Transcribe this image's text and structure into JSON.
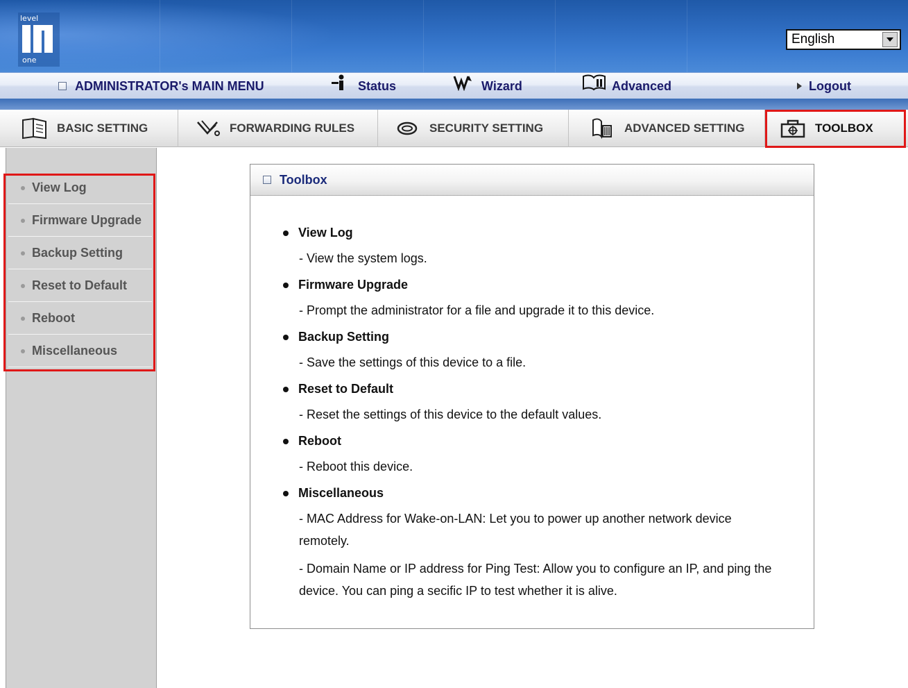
{
  "header": {
    "logo_text": [
      "level",
      "one"
    ],
    "language": "English"
  },
  "main_menu": {
    "title": "ADMINISTRATOR's MAIN MENU",
    "status": "Status",
    "wizard": "Wizard",
    "advanced": "Advanced",
    "logout": "Logout"
  },
  "tabs": [
    {
      "label": "BASIC SETTING",
      "icon": "book-icon"
    },
    {
      "label": "FORWARDING RULES",
      "icon": "forward-arrows-icon"
    },
    {
      "label": "SECURITY SETTING",
      "icon": "lock-chain-icon"
    },
    {
      "label": "ADVANCED SETTING",
      "icon": "advanced-book-icon"
    },
    {
      "label": "TOOLBOX",
      "icon": "toolbox-icon",
      "active": true
    }
  ],
  "sidebar": {
    "items": [
      {
        "label": "View Log"
      },
      {
        "label": "Firmware Upgrade"
      },
      {
        "label": "Backup Setting"
      },
      {
        "label": "Reset to Default"
      },
      {
        "label": "Reboot"
      },
      {
        "label": "Miscellaneous"
      }
    ]
  },
  "panel": {
    "title": "Toolbox",
    "entries": [
      {
        "title": "View Log",
        "desc": [
          "- View the system logs."
        ]
      },
      {
        "title": "Firmware Upgrade",
        "desc": [
          "- Prompt the administrator for a file and upgrade it to this device."
        ]
      },
      {
        "title": "Backup Setting",
        "desc": [
          "- Save the settings of this device to a file."
        ]
      },
      {
        "title": "Reset to Default",
        "desc": [
          "- Reset the settings of this device to the default values."
        ]
      },
      {
        "title": "Reboot",
        "desc": [
          "- Reboot this device."
        ]
      },
      {
        "title": "Miscellaneous",
        "desc": [
          "- MAC Address for Wake-on-LAN: Let you to power up another network device remotely.",
          "- Domain Name or IP address for Ping Test: Allow you to configure an IP, and ping the device. You can ping a secific IP to test whether it is alive."
        ]
      }
    ]
  },
  "colors": {
    "highlight": "#e01818",
    "banner_blue": "#2e6cc0",
    "menu_text": "#0b1f6b"
  }
}
